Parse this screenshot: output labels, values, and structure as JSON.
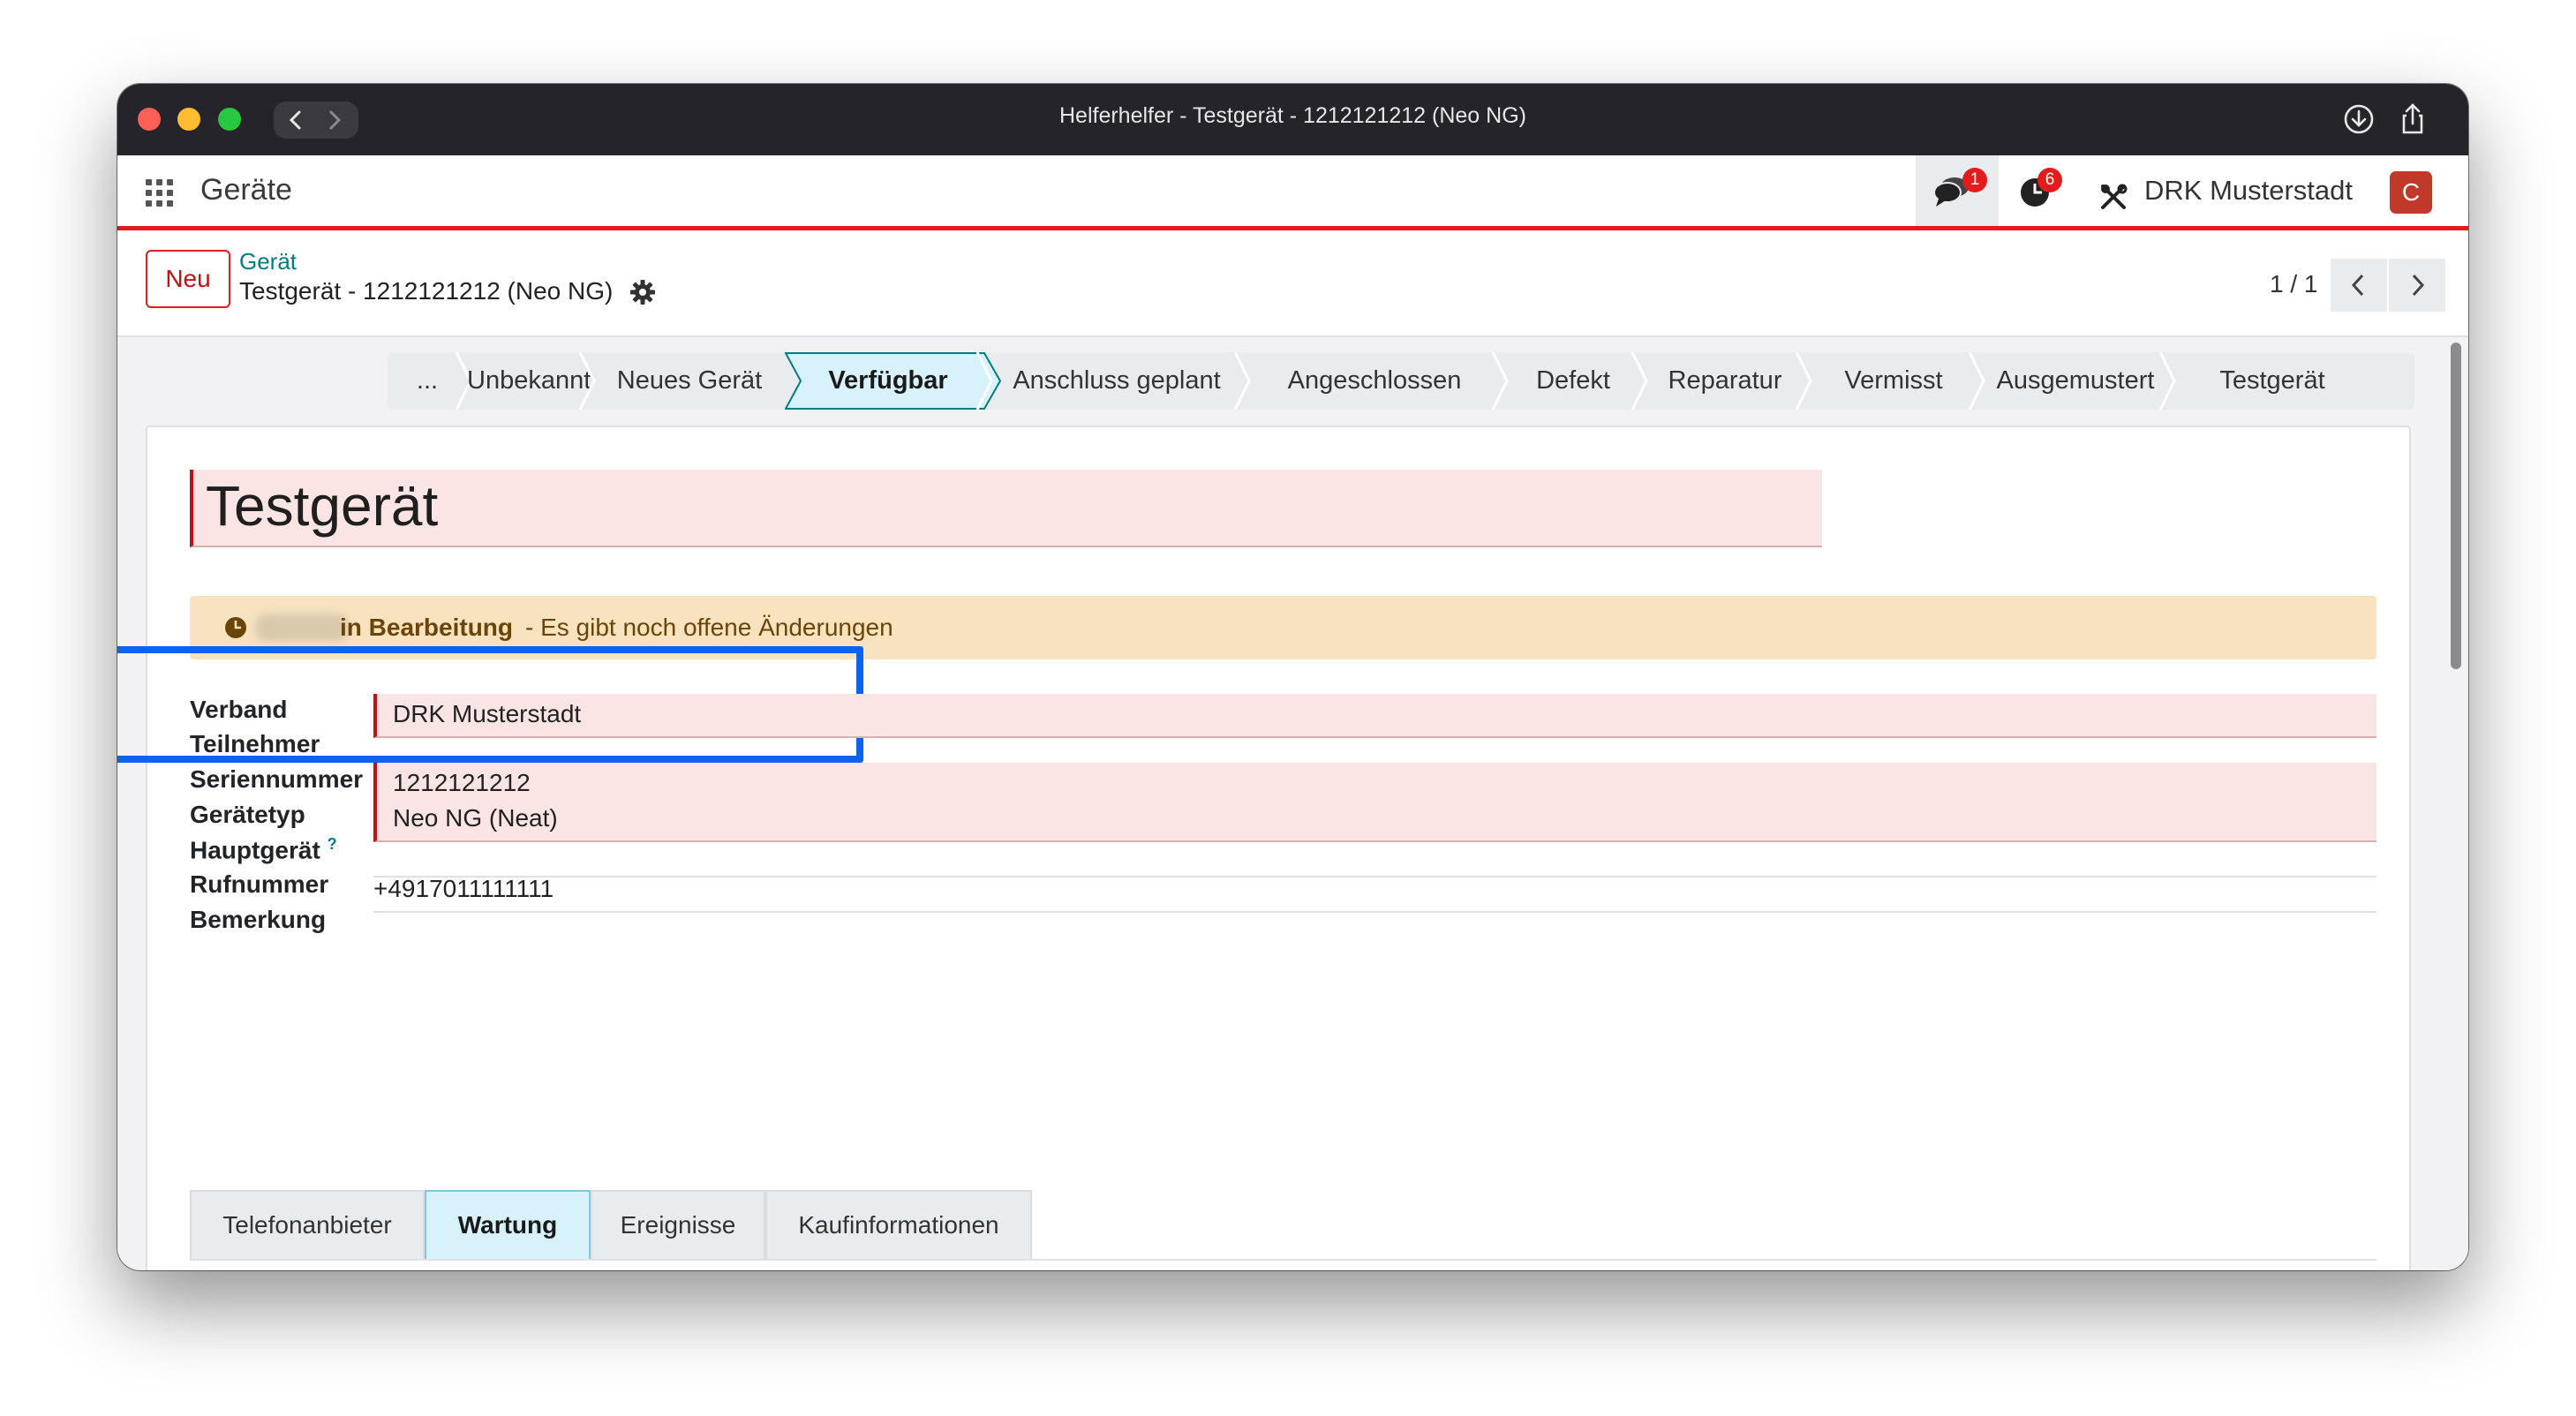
{
  "window": {
    "title": "Helferhelfer - Testgerät - 1212121212 (Neo NG)"
  },
  "appbar": {
    "app_title": "Geräte",
    "messages_badge": "1",
    "activities_badge": "6",
    "company": "DRK Musterstadt",
    "avatar_letter": "C"
  },
  "control_panel": {
    "new_label": "Neu",
    "breadcrumb_parent": "Gerät",
    "breadcrumb_current": "Testgerät - 1212121212 (Neo NG)",
    "pager": "1 / 1"
  },
  "statusbar": {
    "stages": [
      "...",
      "Unbekannt",
      "Neues Gerät",
      "Verfügbar",
      "Anschluss geplant",
      "Angeschlossen",
      "Defekt",
      "Reparatur",
      "Vermisst",
      "Ausgemustert",
      "Testgerät"
    ],
    "active": "Verfügbar"
  },
  "form": {
    "title": "Testgerät",
    "alert": {
      "strong": "in Bearbeitung",
      "rest": "- Es gibt noch offene Änderungen"
    },
    "fields": [
      {
        "label": "Verband",
        "value": "DRK Musterstadt"
      },
      {
        "label": "Teilnehmer",
        "value": ""
      },
      {
        "label": "Seriennummer",
        "value": "1212121212"
      },
      {
        "label": "Gerätetyp",
        "value": "Neo NG (Neat)"
      },
      {
        "label": "Hauptgerät",
        "value": "",
        "help": "?"
      },
      {
        "label": "Rufnummer",
        "value": "+4917011111111"
      },
      {
        "label": "Bemerkung",
        "value": ""
      }
    ],
    "tabs": [
      "Telefonanbieter",
      "Wartung",
      "Ereignisse",
      "Kaufinformationen"
    ],
    "active_tab": "Wartung"
  },
  "colors": {
    "accent_red": "#e41b1b",
    "link_teal": "#017e84",
    "alert_bg": "#f8e3c0",
    "highlight_blue": "#0a64f0",
    "active_stage_bg": "#d7f2fb"
  },
  "icons": [
    "apps-grid-icon",
    "chat-icon",
    "clock-icon",
    "tools-icon",
    "gear-icon",
    "chevron-left-icon",
    "chevron-right-icon",
    "download-icon",
    "share-icon"
  ]
}
